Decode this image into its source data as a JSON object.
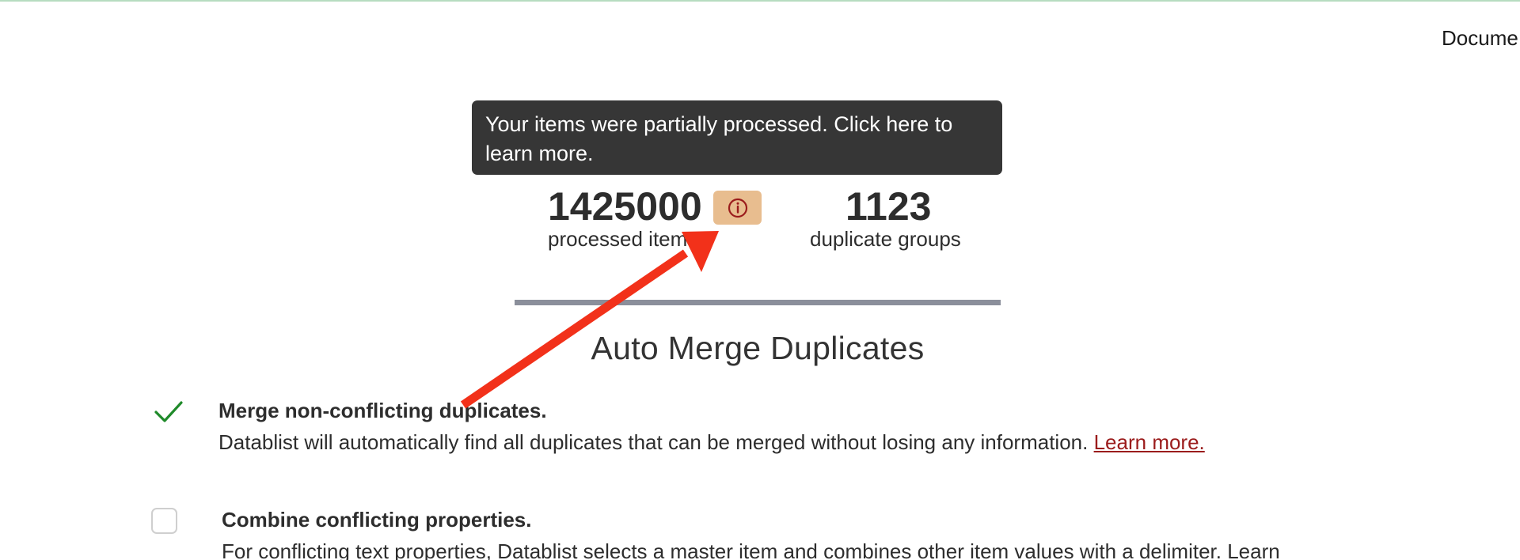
{
  "header": {
    "docs_link": "Docume"
  },
  "tooltip": {
    "text": "Your items were partially processed. Click here to learn more."
  },
  "stats": {
    "processed_count": "1425000",
    "processed_label": "processed items",
    "groups_count": "1123",
    "groups_label": "duplicate groups",
    "info_icon": "info-circle-icon"
  },
  "section": {
    "title": "Auto Merge Duplicates"
  },
  "options": [
    {
      "title": "Merge non-conflicting duplicates.",
      "description": "Datablist will automatically find all duplicates that can be merged without losing any information.",
      "link": "Learn more.",
      "checked": true
    },
    {
      "title": "Combine conflicting properties.",
      "description": "For conflicting text properties, Datablist selects a master item and combines other item values with a delimiter.",
      "link": "Learn",
      "checked": false
    }
  ],
  "colors": {
    "tooltip_bg": "#363636",
    "badge_bg": "#e8bd8f",
    "icon_red": "#9b1c1c",
    "check_green": "#1f8a2a",
    "annotation_arrow": "#f2311a"
  }
}
